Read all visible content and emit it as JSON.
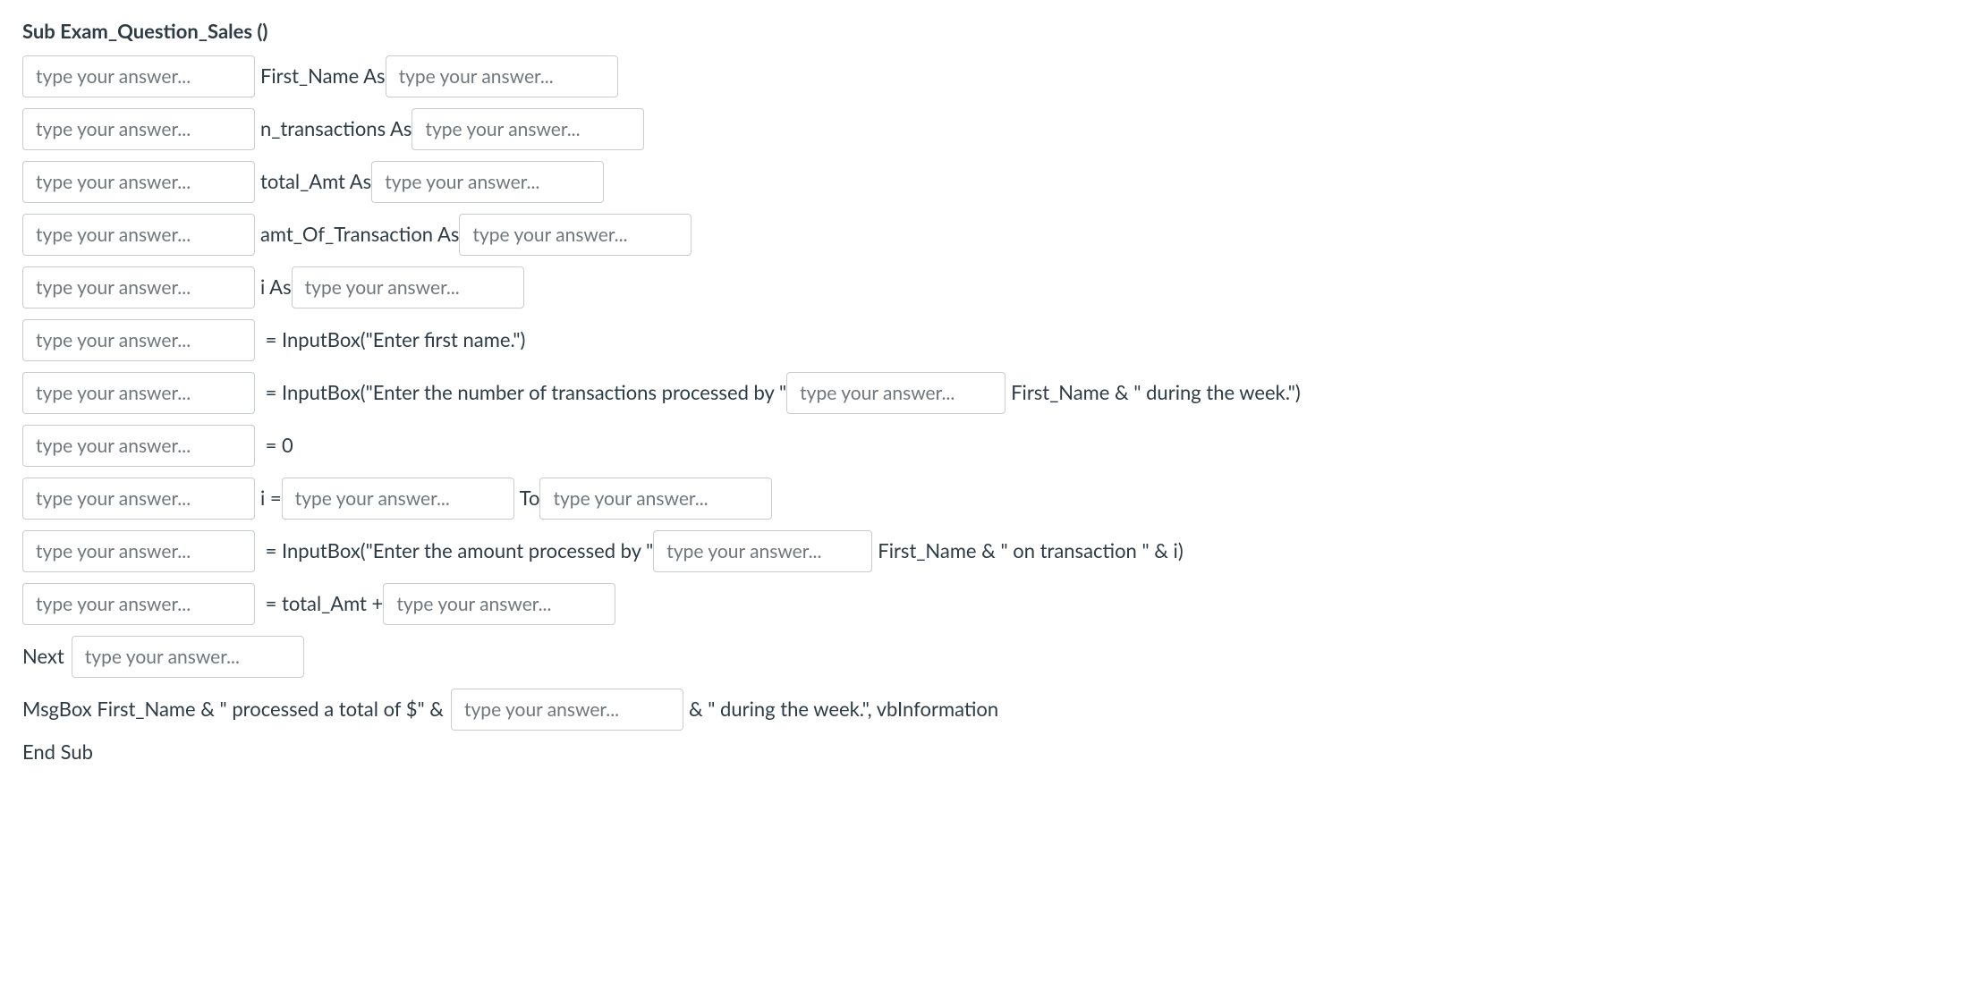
{
  "placeholder": "type your answer...",
  "lines": {
    "title": "Sub Exam_Question_Sales ()",
    "l1_mid": "First_Name As",
    "l2_mid": "n_transactions As",
    "l3_mid": "total_Amt As",
    "l4_mid": "amt_Of_Transaction As",
    "l5_mid": "i As",
    "l6_mid": " = InputBox(\"Enter first name.\")",
    "l7_mid": " = InputBox(\"Enter the number of transactions processed by \"",
    "l7_end": "First_Name & \" during the week.\")",
    "l8_mid": " = 0",
    "l9_mid": "i =",
    "l9_to": "To",
    "l10_mid": " = InputBox(\"Enter the amount processed by \"",
    "l10_end": "First_Name & \" on transaction \" & i)",
    "l11_mid": " = total_Amt +",
    "l12_pre": "Next",
    "l13_pre": "MsgBox First_Name & \" processed a total of $\" &",
    "l13_end": "& \" during the week.\", vbInformation",
    "l14": "End Sub"
  }
}
